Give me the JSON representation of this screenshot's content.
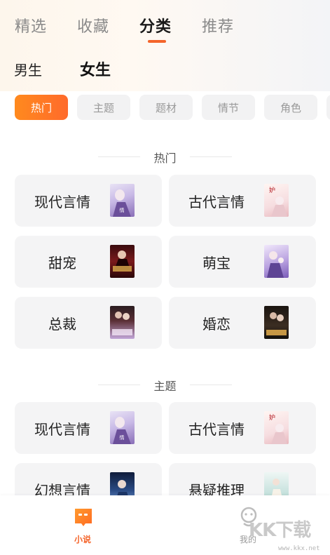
{
  "top_tabs": [
    {
      "label": "精选"
    },
    {
      "label": "收藏"
    },
    {
      "label": "分类"
    },
    {
      "label": "推荐"
    }
  ],
  "active_tab": "分类",
  "gender": {
    "male": "男生",
    "female": "女生",
    "active": "女生"
  },
  "chips": [
    {
      "label": "热门"
    },
    {
      "label": "主题"
    },
    {
      "label": "题材"
    },
    {
      "label": "情节"
    },
    {
      "label": "角色"
    }
  ],
  "sections": [
    {
      "title": "热门",
      "items": [
        {
          "label": "现代言情",
          "cover": "cover-lavender"
        },
        {
          "label": "古代言情",
          "cover": "cover-pink-white"
        },
        {
          "label": "甜宠",
          "cover": "cover-red-dark"
        },
        {
          "label": "萌宝",
          "cover": "cover-purple"
        },
        {
          "label": "总裁",
          "cover": "cover-dark-couple"
        },
        {
          "label": "婚恋",
          "cover": "cover-dark-gold"
        }
      ]
    },
    {
      "title": "主题",
      "items": [
        {
          "label": "现代言情",
          "cover": "cover-lavender"
        },
        {
          "label": "古代言情",
          "cover": "cover-pink-white"
        },
        {
          "label": "幻想言情",
          "cover": "cover-blue-night"
        },
        {
          "label": "悬疑推理",
          "cover": "cover-teal-light"
        }
      ]
    }
  ],
  "bottom_nav": [
    {
      "label": "小说",
      "icon": "book-icon",
      "active": true
    },
    {
      "label": "我的",
      "icon": "user-icon",
      "active": false
    }
  ],
  "watermark": {
    "text": "KK下载",
    "url": "www.kkx.net"
  },
  "colors": {
    "accent": "#f4642a",
    "chip_gradient_start": "#ff8a1e",
    "chip_gradient_end": "#ff6a2b",
    "card_bg": "#f4f4f5"
  }
}
